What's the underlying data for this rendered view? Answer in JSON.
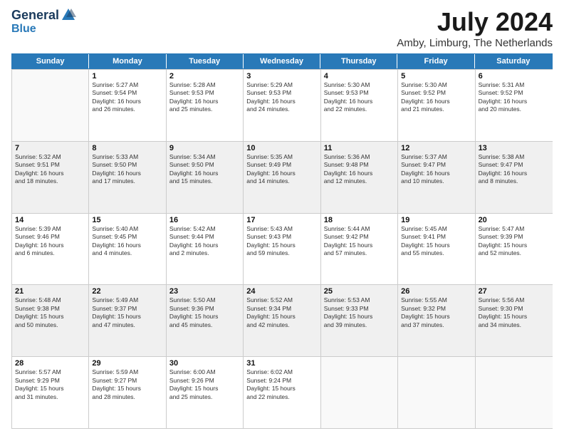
{
  "logo": {
    "general": "General",
    "blue": "Blue"
  },
  "title": "July 2024",
  "location": "Amby, Limburg, The Netherlands",
  "days": [
    "Sunday",
    "Monday",
    "Tuesday",
    "Wednesday",
    "Thursday",
    "Friday",
    "Saturday"
  ],
  "weeks": [
    [
      {
        "day": "",
        "empty": true
      },
      {
        "day": "1",
        "sunrise": "5:27 AM",
        "sunset": "9:54 PM",
        "daylight": "16 hours and 26 minutes."
      },
      {
        "day": "2",
        "sunrise": "5:28 AM",
        "sunset": "9:53 PM",
        "daylight": "16 hours and 25 minutes."
      },
      {
        "day": "3",
        "sunrise": "5:29 AM",
        "sunset": "9:53 PM",
        "daylight": "16 hours and 24 minutes."
      },
      {
        "day": "4",
        "sunrise": "5:30 AM",
        "sunset": "9:53 PM",
        "daylight": "16 hours and 22 minutes."
      },
      {
        "day": "5",
        "sunrise": "5:30 AM",
        "sunset": "9:52 PM",
        "daylight": "16 hours and 21 minutes."
      },
      {
        "day": "6",
        "sunrise": "5:31 AM",
        "sunset": "9:52 PM",
        "daylight": "16 hours and 20 minutes."
      }
    ],
    [
      {
        "day": "7",
        "sunrise": "5:32 AM",
        "sunset": "9:51 PM",
        "daylight": "16 hours and 18 minutes."
      },
      {
        "day": "8",
        "sunrise": "5:33 AM",
        "sunset": "9:50 PM",
        "daylight": "16 hours and 17 minutes."
      },
      {
        "day": "9",
        "sunrise": "5:34 AM",
        "sunset": "9:50 PM",
        "daylight": "16 hours and 15 minutes."
      },
      {
        "day": "10",
        "sunrise": "5:35 AM",
        "sunset": "9:49 PM",
        "daylight": "16 hours and 14 minutes."
      },
      {
        "day": "11",
        "sunrise": "5:36 AM",
        "sunset": "9:48 PM",
        "daylight": "16 hours and 12 minutes."
      },
      {
        "day": "12",
        "sunrise": "5:37 AM",
        "sunset": "9:47 PM",
        "daylight": "16 hours and 10 minutes."
      },
      {
        "day": "13",
        "sunrise": "5:38 AM",
        "sunset": "9:47 PM",
        "daylight": "16 hours and 8 minutes."
      }
    ],
    [
      {
        "day": "14",
        "sunrise": "5:39 AM",
        "sunset": "9:46 PM",
        "daylight": "16 hours and 6 minutes."
      },
      {
        "day": "15",
        "sunrise": "5:40 AM",
        "sunset": "9:45 PM",
        "daylight": "16 hours and 4 minutes."
      },
      {
        "day": "16",
        "sunrise": "5:42 AM",
        "sunset": "9:44 PM",
        "daylight": "16 hours and 2 minutes."
      },
      {
        "day": "17",
        "sunrise": "5:43 AM",
        "sunset": "9:43 PM",
        "daylight": "15 hours and 59 minutes."
      },
      {
        "day": "18",
        "sunrise": "5:44 AM",
        "sunset": "9:42 PM",
        "daylight": "15 hours and 57 minutes."
      },
      {
        "day": "19",
        "sunrise": "5:45 AM",
        "sunset": "9:41 PM",
        "daylight": "15 hours and 55 minutes."
      },
      {
        "day": "20",
        "sunrise": "5:47 AM",
        "sunset": "9:39 PM",
        "daylight": "15 hours and 52 minutes."
      }
    ],
    [
      {
        "day": "21",
        "sunrise": "5:48 AM",
        "sunset": "9:38 PM",
        "daylight": "15 hours and 50 minutes."
      },
      {
        "day": "22",
        "sunrise": "5:49 AM",
        "sunset": "9:37 PM",
        "daylight": "15 hours and 47 minutes."
      },
      {
        "day": "23",
        "sunrise": "5:50 AM",
        "sunset": "9:36 PM",
        "daylight": "15 hours and 45 minutes."
      },
      {
        "day": "24",
        "sunrise": "5:52 AM",
        "sunset": "9:34 PM",
        "daylight": "15 hours and 42 minutes."
      },
      {
        "day": "25",
        "sunrise": "5:53 AM",
        "sunset": "9:33 PM",
        "daylight": "15 hours and 39 minutes."
      },
      {
        "day": "26",
        "sunrise": "5:55 AM",
        "sunset": "9:32 PM",
        "daylight": "15 hours and 37 minutes."
      },
      {
        "day": "27",
        "sunrise": "5:56 AM",
        "sunset": "9:30 PM",
        "daylight": "15 hours and 34 minutes."
      }
    ],
    [
      {
        "day": "28",
        "sunrise": "5:57 AM",
        "sunset": "9:29 PM",
        "daylight": "15 hours and 31 minutes."
      },
      {
        "day": "29",
        "sunrise": "5:59 AM",
        "sunset": "9:27 PM",
        "daylight": "15 hours and 28 minutes."
      },
      {
        "day": "30",
        "sunrise": "6:00 AM",
        "sunset": "9:26 PM",
        "daylight": "15 hours and 25 minutes."
      },
      {
        "day": "31",
        "sunrise": "6:02 AM",
        "sunset": "9:24 PM",
        "daylight": "15 hours and 22 minutes."
      },
      {
        "day": "",
        "empty": true
      },
      {
        "day": "",
        "empty": true
      },
      {
        "day": "",
        "empty": true
      }
    ]
  ]
}
